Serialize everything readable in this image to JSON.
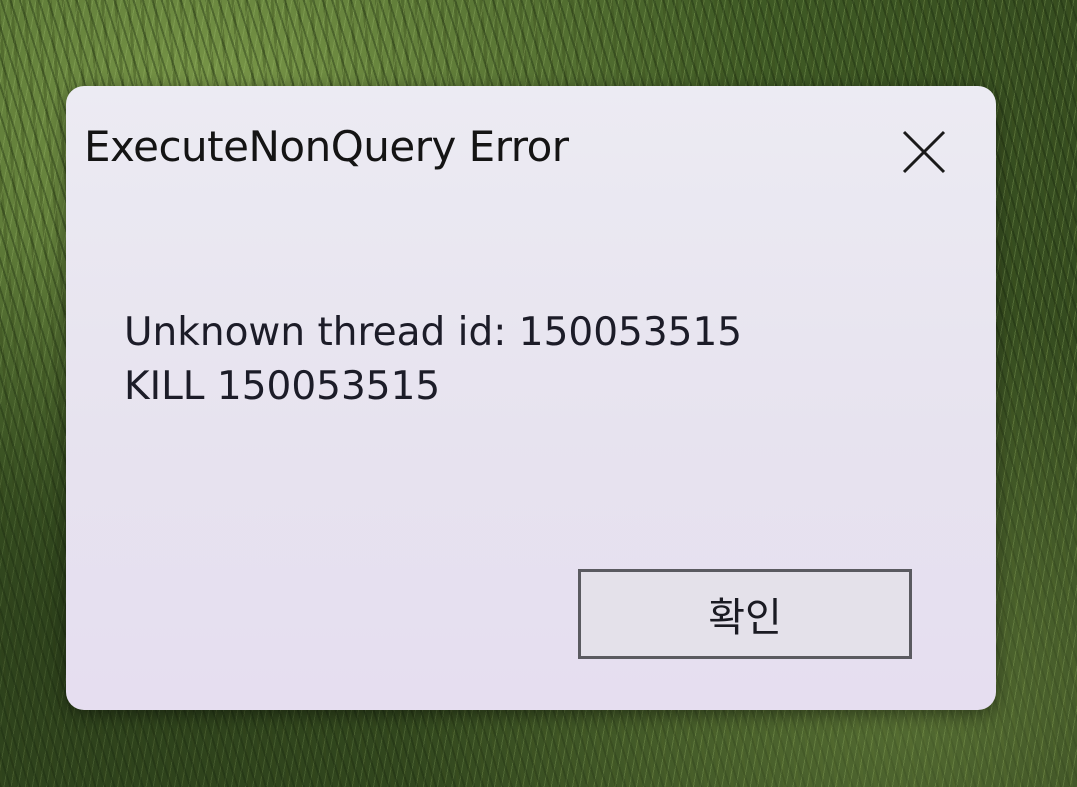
{
  "dialog": {
    "title": "ExecuteNonQuery Error",
    "close_icon": "close-icon",
    "message_lines": [
      "Unknown thread id: 150053515",
      "KILL 150053515"
    ],
    "ok_label": "확인"
  }
}
